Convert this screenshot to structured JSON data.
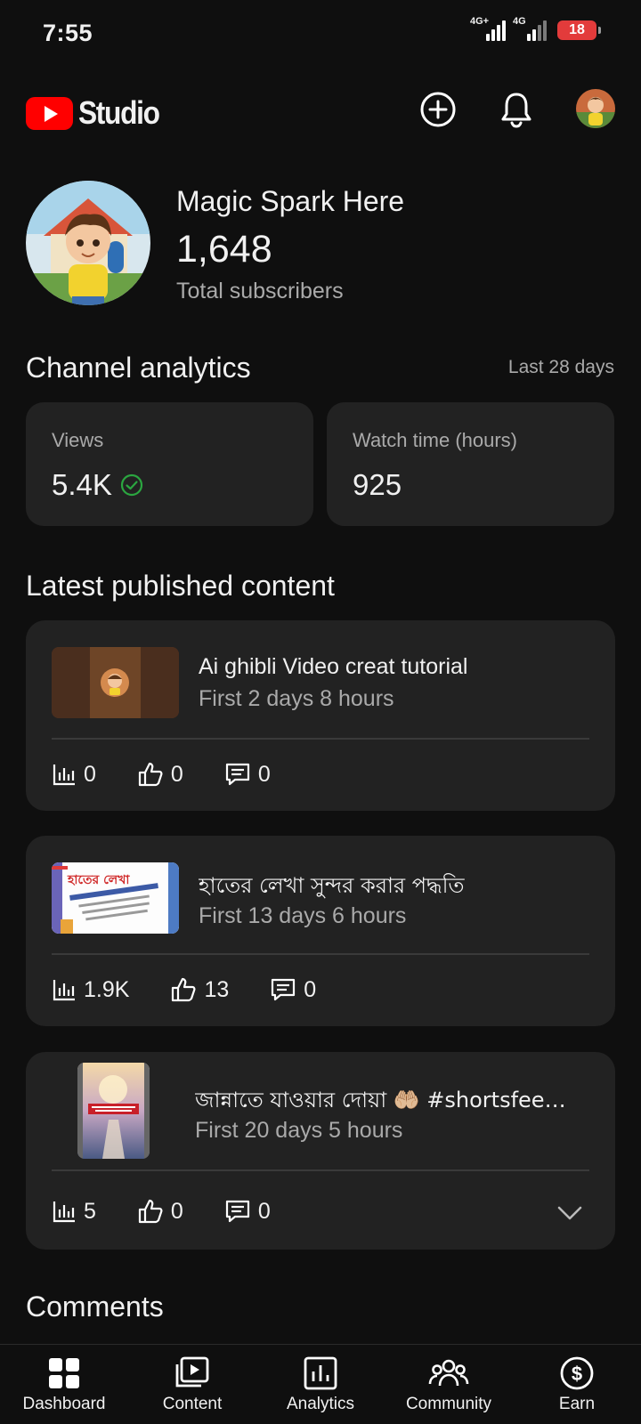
{
  "status_bar": {
    "time": "7:55",
    "network1": "4G+",
    "network2": "4G",
    "battery": "18"
  },
  "header": {
    "logo_text": "Studio"
  },
  "channel": {
    "name": "Magic Spark Here",
    "subscribers": "1,648",
    "subscribers_label": "Total subscribers"
  },
  "analytics": {
    "title": "Channel analytics",
    "period": "Last 28 days",
    "views_label": "Views",
    "views_value": "5.4K",
    "watch_label": "Watch time (hours)",
    "watch_value": "925"
  },
  "content": {
    "title": "Latest published content",
    "items": [
      {
        "title": "Ai ghibli Video creat tutorial",
        "age": "First 2 days 8 hours",
        "views": "0",
        "likes": "0",
        "comments": "0"
      },
      {
        "title": "হাতের লেখা সুন্দর করার পদ্ধতি",
        "age": "First 13 days 6 hours",
        "views": "1.9K",
        "likes": "13",
        "comments": "0",
        "thumb_text": "হাতের লেখা"
      },
      {
        "title": "জান্নাতে যাওয়ার দোয়া 🤲🏼 #shortsfee…",
        "age": "First 20 days 5 hours",
        "views": "5",
        "likes": "0",
        "comments": "0"
      }
    ]
  },
  "comments": {
    "title": "Comments"
  },
  "nav": {
    "dashboard": "Dashboard",
    "content": "Content",
    "analytics": "Analytics",
    "community": "Community",
    "earn": "Earn"
  },
  "colors": {
    "background": "#0f0f0f",
    "card": "#222222",
    "brand_red": "#ff0000",
    "check_green": "#2ba640",
    "muted_text": "#aaaaaa"
  }
}
